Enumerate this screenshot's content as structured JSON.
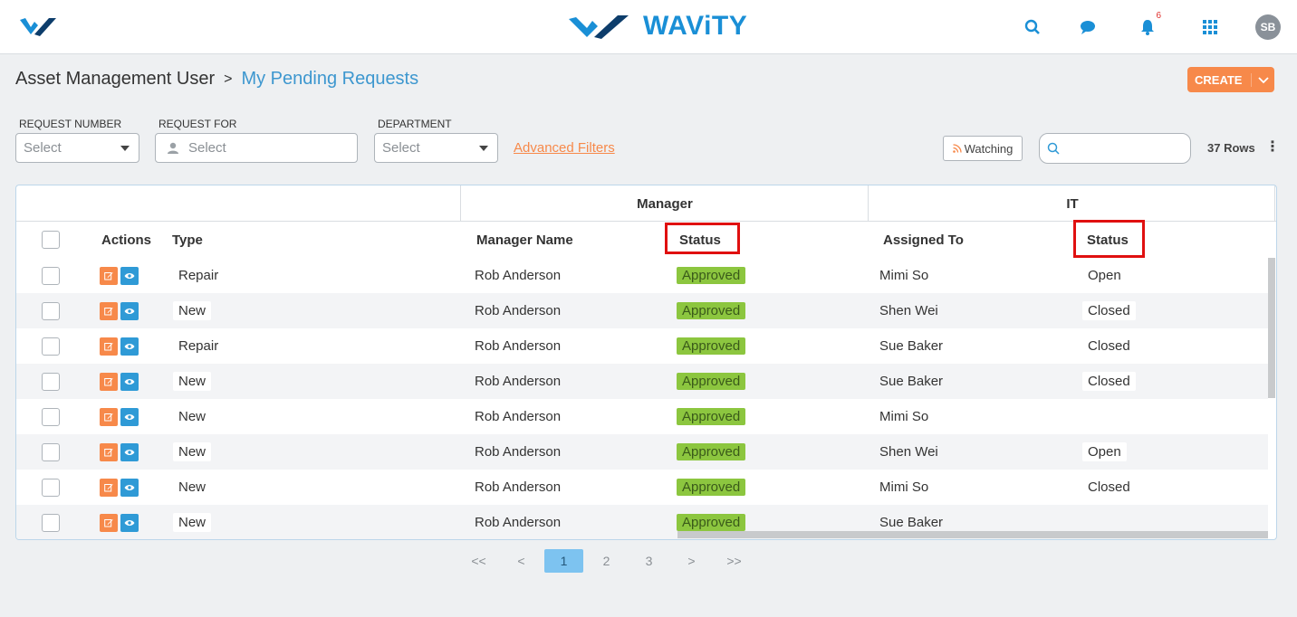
{
  "brand": {
    "name": "WAViTY",
    "color": "#1a8fd6"
  },
  "topbar": {
    "icons": [
      "search-icon",
      "chat-icon",
      "bell-icon",
      "apps-grid-icon"
    ],
    "notification_count": "6",
    "avatar_initials": "SB"
  },
  "breadcrumb": {
    "root": "Asset Management User",
    "separator": ">",
    "current": "My Pending Requests"
  },
  "create_button": {
    "label": "CREATE"
  },
  "filters": {
    "request_number": {
      "label": "REQUEST NUMBER",
      "placeholder": "Select"
    },
    "request_for": {
      "label": "REQUEST FOR",
      "placeholder": "Select"
    },
    "department": {
      "label": "DEPARTMENT",
      "placeholder": "Select"
    },
    "advanced": "Advanced Filters"
  },
  "toolbar": {
    "watching": "Watching",
    "rows_count": "37 Rows",
    "search_value": ""
  },
  "table": {
    "groups": {
      "manager": "Manager",
      "it": "IT"
    },
    "columns": {
      "actions": "Actions",
      "type": "Type",
      "manager_name": "Manager Name",
      "manager_status": "Status",
      "assigned_to": "Assigned To",
      "it_status": "Status"
    },
    "rows": [
      {
        "type": "Repair",
        "manager_name": "Rob Anderson",
        "manager_status": "Approved",
        "assigned_to": "Mimi So",
        "it_status": "Open"
      },
      {
        "type": "New",
        "manager_name": "Rob Anderson",
        "manager_status": "Approved",
        "assigned_to": "Shen Wei",
        "it_status": "Closed"
      },
      {
        "type": "Repair",
        "manager_name": "Rob Anderson",
        "manager_status": "Approved",
        "assigned_to": "Sue Baker",
        "it_status": "Closed"
      },
      {
        "type": "New",
        "manager_name": "Rob Anderson",
        "manager_status": "Approved",
        "assigned_to": "Sue Baker",
        "it_status": "Closed"
      },
      {
        "type": "New",
        "manager_name": "Rob Anderson",
        "manager_status": "Approved",
        "assigned_to": "Mimi So",
        "it_status": ""
      },
      {
        "type": "New",
        "manager_name": "Rob Anderson",
        "manager_status": "Approved",
        "assigned_to": "Shen Wei",
        "it_status": "Open"
      },
      {
        "type": "New",
        "manager_name": "Rob Anderson",
        "manager_status": "Approved",
        "assigned_to": "Mimi So",
        "it_status": "Closed"
      },
      {
        "type": "New",
        "manager_name": "Rob Anderson",
        "manager_status": "Approved",
        "assigned_to": "Sue Baker",
        "it_status": ""
      }
    ]
  },
  "pagination": {
    "first": "<<",
    "prev": "<",
    "pages": [
      "1",
      "2",
      "3"
    ],
    "current": "1",
    "next": ">",
    "last": ">>"
  },
  "colors": {
    "accent_orange": "#f7894a",
    "accent_blue": "#2f9ad6",
    "approved_green": "#8cc63f",
    "highlight_red": "#e01010"
  }
}
